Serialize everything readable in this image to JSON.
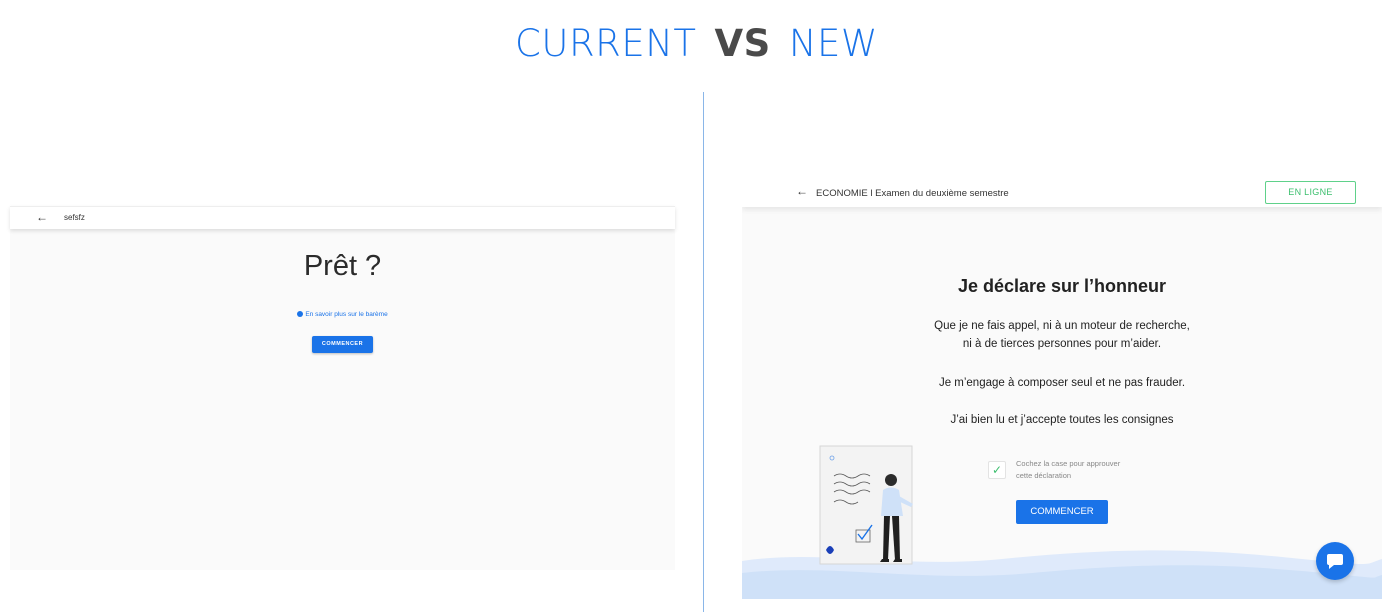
{
  "title": {
    "left": "CURRENT",
    "vs": "VS",
    "right": "NEW"
  },
  "current": {
    "topbar_title": "sefsfz",
    "heading": "Prêt ?",
    "info_link": "En savoir plus sur le barème",
    "start_button": "COMMENCER"
  },
  "new": {
    "topbar_title": "ECONOMIE l Examen du deuxième semestre",
    "status_badge": "EN LIGNE",
    "heading": "Je déclare sur l’honneur",
    "paragraph1_line1": "Que je ne fais appel, ni à un moteur de recherche,",
    "paragraph1_line2": "ni à de tierces personnes pour m’aider.",
    "paragraph2": "Je m’engage à composer seul et ne pas frauder.",
    "paragraph3": "J’ai bien lu et j’accepte toutes les consignes",
    "checkbox_label_line1": "Cochez la case pour approuver",
    "checkbox_label_line2": "cette déclaration",
    "checkbox_checked": true,
    "start_button": "COMMENCER"
  },
  "colors": {
    "accent": "#1a73e8",
    "status_green": "#3cbf6e",
    "divider": "#8ab6e8",
    "wave": "#cfe1f8"
  },
  "icons": [
    "back-arrow-icon",
    "info-icon",
    "checkmark-icon",
    "chat-icon"
  ]
}
